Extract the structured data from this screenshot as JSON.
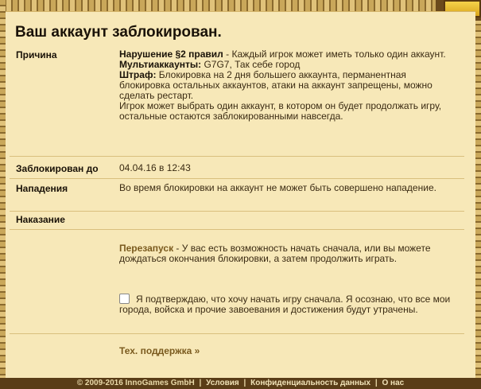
{
  "title": "Ваш аккаунт заблокирован.",
  "reason": {
    "label": "Причина",
    "rule": "Нарушение §2 правил",
    "rule_text": " - Каждый игрок может иметь только один аккаунт.",
    "multi_label": "Мультиаккаунты:",
    "multi_value": " G7G7, Так себе город",
    "penalty_label": "Штраф:",
    "penalty_text": " Блокировка на 2 дня большего аккаунта, перманентная блокировка остальных аккаунтов, атаки на аккаунт запрещены, можно сделать рестарт.",
    "choice_text": "Игрок может выбрать один аккаунт, в котором он будет продолжать игру, остальные остаются заблокированными навсегда."
  },
  "blocked_until": {
    "label": "Заблокирован до",
    "value": "04.04.16 в 12:43"
  },
  "attacks": {
    "label": "Нападения",
    "value": "Во время блокировки на аккаунт не может быть совершено нападение."
  },
  "punishment": {
    "label": "Наказание",
    "restart_label": "Перезапуск",
    "restart_text": " - У вас есть возможность начать сначала, или вы можете дождаться окончания блокировки, а затем продолжить играть.",
    "confirm_text": "Я подтверждаю, что хочу начать игру сначала. Я осознаю, что все мои города, войска и прочие завоевания и достижения будут утрачены.",
    "support_link": "Тех. поддержка »"
  },
  "footer": {
    "copyright": "© 2009-2016 InnoGames GmbH",
    "sep": "|",
    "terms": "Условия",
    "privacy": "Конфиденциальность данных",
    "about": "О нас"
  }
}
